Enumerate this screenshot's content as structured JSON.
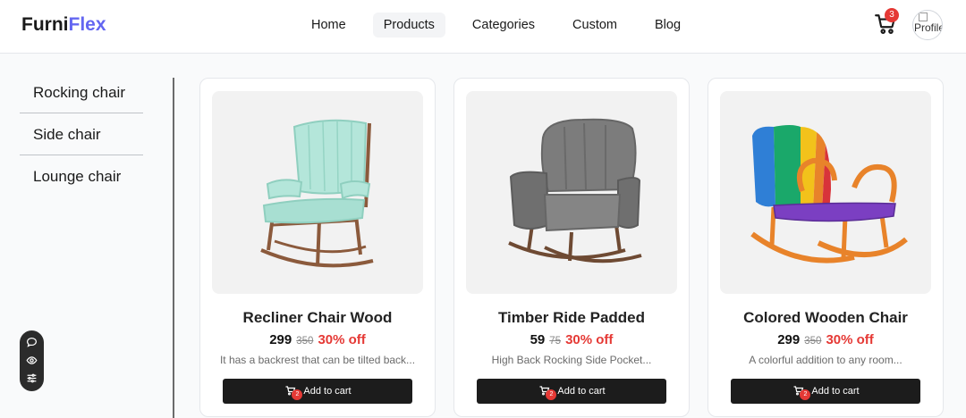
{
  "header": {
    "logo_primary": "Furni",
    "logo_accent": "Flex",
    "cart_count": "3",
    "avatar_alt": "Profile"
  },
  "nav": [
    {
      "label": "Home"
    },
    {
      "label": "Products",
      "active": true
    },
    {
      "label": "Categories"
    },
    {
      "label": "Custom"
    },
    {
      "label": "Blog"
    }
  ],
  "sidebar": {
    "categories": [
      {
        "label": "Rocking chair"
      },
      {
        "label": "Side chair"
      },
      {
        "label": "Lounge chair"
      }
    ]
  },
  "products": [
    {
      "title": "Recliner Chair Wood",
      "price": "299",
      "old_price": "350",
      "discount": "30% off",
      "description": "It has a backrest that can be tilted back...",
      "button_label": "Add to cart",
      "cart_badge": "2"
    },
    {
      "title": "Timber Ride Padded",
      "price": "59",
      "old_price": "75",
      "discount": "30% off",
      "description": "High Back Rocking Side Pocket...",
      "button_label": "Add to cart",
      "cart_badge": "2"
    },
    {
      "title": "Colored Wooden Chair",
      "price": "299",
      "old_price": "350",
      "discount": "30% off",
      "description": "A colorful addition to any room...",
      "button_label": "Add to cart",
      "cart_badge": "2"
    }
  ],
  "colors": {
    "accent": "#6366f1",
    "discount": "#e53935",
    "button": "#1c1c1c"
  },
  "icons": [
    "cart-icon",
    "chat-icon",
    "eye-icon",
    "settings-icon"
  ]
}
